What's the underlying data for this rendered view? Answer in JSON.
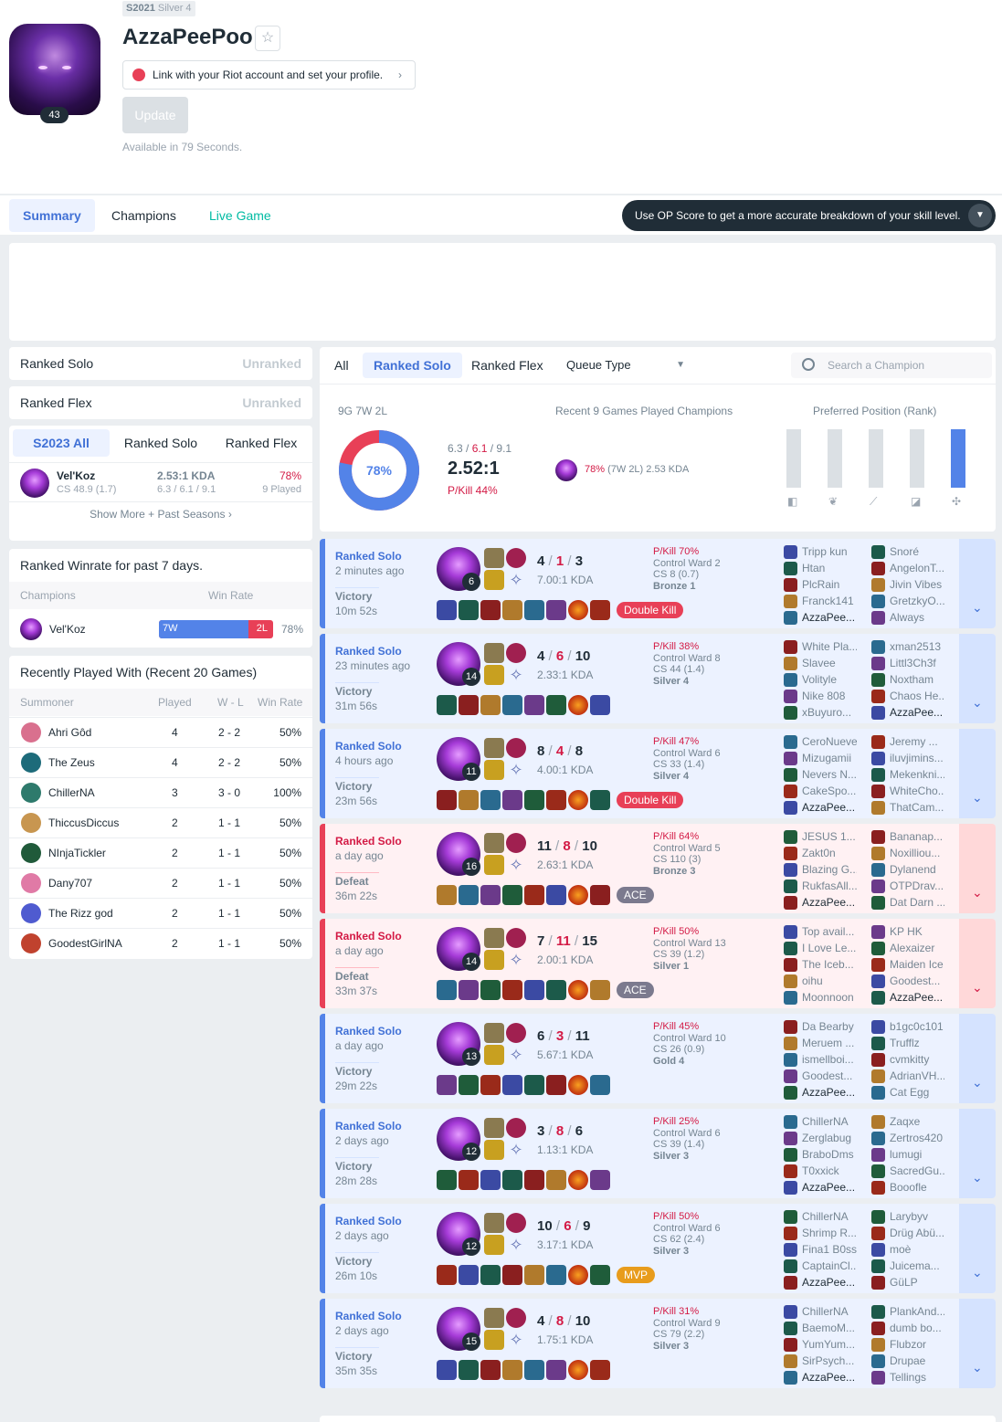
{
  "profile": {
    "tier_tag_season": "S2021",
    "tier_tag_rank": "Silver 4",
    "name": "AzzaPeePoo",
    "level": "43",
    "riot_link": "Link with your Riot account and set your profile.",
    "update_label": "Update",
    "available": "Available in 79 Seconds."
  },
  "tabs": {
    "summary": "Summary",
    "champions": "Champions",
    "live": "Live Game",
    "op_score": "Use OP Score to get a more accurate breakdown of your skill level."
  },
  "ranked": {
    "solo_label": "Ranked Solo",
    "solo_value": "Unranked",
    "flex_label": "Ranked Flex",
    "flex_value": "Unranked"
  },
  "season": {
    "tabs": [
      "S2023 All",
      "Ranked Solo",
      "Ranked Flex"
    ],
    "champ": "Vel'Koz",
    "cs": "CS 48.9 (1.7)",
    "kda": "2.53:1 KDA",
    "kda_detail": "6.3 / 6.1 / 9.1",
    "winrate": "78%",
    "played": "9 Played",
    "more": "Show More + Past Seasons"
  },
  "winrate7": {
    "title": "Ranked Winrate for past 7 days.",
    "col_champ": "Champions",
    "col_wr": "Win Rate",
    "champ": "Vel'Koz",
    "wins": "7W",
    "losses": "2L",
    "wr": "78%",
    "win_fraction": 0.78
  },
  "recent": {
    "title": "Recently Played With (Recent 20 Games)",
    "cols": [
      "Summoner",
      "Played",
      "W - L",
      "Win Rate"
    ],
    "rows": [
      {
        "name": "Ahri Gôd",
        "played": "4",
        "wl": "2 - 2",
        "wr": "50%",
        "color": "#d9708e"
      },
      {
        "name": "The Zeus",
        "played": "4",
        "wl": "2 - 2",
        "wr": "50%",
        "color": "#1d6b7a"
      },
      {
        "name": "ChillerNA",
        "played": "3",
        "wl": "3 - 0",
        "wr": "100%",
        "color": "#2e7a6c"
      },
      {
        "name": "ThiccusDiccus",
        "played": "2",
        "wl": "1 - 1",
        "wr": "50%",
        "color": "#c89650"
      },
      {
        "name": "NInjaTickler",
        "played": "2",
        "wl": "1 - 1",
        "wr": "50%",
        "color": "#205a3a"
      },
      {
        "name": "Dany707",
        "played": "2",
        "wl": "1 - 1",
        "wr": "50%",
        "color": "#e07aa6"
      },
      {
        "name": "The Rizz god",
        "played": "2",
        "wl": "1 - 1",
        "wr": "50%",
        "color": "#4f5bd0"
      },
      {
        "name": "GoodestGirlNA",
        "played": "2",
        "wl": "1 - 1",
        "wr": "50%",
        "color": "#c0422e"
      }
    ]
  },
  "filters": {
    "all": "All",
    "solo": "Ranked Solo",
    "flex": "Ranked Flex",
    "queue": "Queue Type",
    "search": "Search a Champion"
  },
  "summary": {
    "record": "9G 7W 2L",
    "winrate": "78%",
    "win_fraction": 0.78,
    "kda_line_k": "6.3",
    "kda_line_d": "6.1",
    "kda_line_a": "9.1",
    "kda": "2.52:1",
    "pkill": "P/Kill 44%",
    "recent_title": "Recent 9 Games Played Champions",
    "recent_wr": "78%",
    "recent_wl": "(7W 2L)",
    "recent_kda": "2.53 KDA",
    "pos_title": "Preferred Position (Rank)",
    "positions": [
      {
        "name": "top",
        "share": 0
      },
      {
        "name": "jungle",
        "share": 0
      },
      {
        "name": "mid",
        "share": 0
      },
      {
        "name": "adc",
        "share": 0
      },
      {
        "name": "support",
        "share": 1
      }
    ]
  },
  "matches": [
    {
      "queue": "Ranked Solo",
      "time": "2 minutes ago",
      "result": "Victory",
      "duration": "10m 52s",
      "lv": "6",
      "k": "4",
      "d": "1",
      "a": "3",
      "kda": "7.00:1 KDA",
      "pkill": "P/Kill 70%",
      "ward": "Control Ward 2",
      "cs": "CS 8 (0.7)",
      "tier": "Bronze 1",
      "badge": "Double Kill",
      "win": true,
      "team1": [
        "Tripp kun",
        "Htan",
        "PlcRain",
        "Franck141",
        "AzzaPee..."
      ],
      "team2": [
        "Snoré",
        "AngelonT...",
        "Jivin Vibes",
        "GretzkyO...",
        "Always"
      ]
    },
    {
      "queue": "Ranked Solo",
      "time": "23 minutes ago",
      "result": "Victory",
      "duration": "31m 56s",
      "lv": "14",
      "k": "4",
      "d": "6",
      "a": "10",
      "kda": "2.33:1 KDA",
      "pkill": "P/Kill 38%",
      "ward": "Control Ward 8",
      "cs": "CS 44 (1.4)",
      "tier": "Silver 4",
      "badge": "",
      "win": true,
      "team1": [
        "White Pla...",
        "Slavee",
        "Volityle",
        "Nike 808",
        "xBuyuro..."
      ],
      "team2": [
        "xman2513",
        "Littl3Ch3f",
        "Noxtham",
        "Chaos He...",
        "AzzaPee..."
      ]
    },
    {
      "queue": "Ranked Solo",
      "time": "4 hours ago",
      "result": "Victory",
      "duration": "23m 56s",
      "lv": "11",
      "k": "8",
      "d": "4",
      "a": "8",
      "kda": "4.00:1 KDA",
      "pkill": "P/Kill 47%",
      "ward": "Control Ward 6",
      "cs": "CS 33 (1.4)",
      "tier": "Silver 4",
      "badge": "Double Kill",
      "win": true,
      "team1": [
        "CeroNueve",
        "Mizugamii",
        "Nevers N...",
        "CakeSpo...",
        "AzzaPee..."
      ],
      "team2": [
        "Jeremy ...",
        "iluvjimins...",
        "Mekenkni...",
        "WhiteCho...",
        "ThatCam..."
      ]
    },
    {
      "queue": "Ranked Solo",
      "time": "a day ago",
      "result": "Defeat",
      "duration": "36m 22s",
      "lv": "16",
      "k": "11",
      "d": "8",
      "a": "10",
      "kda": "2.63:1 KDA",
      "pkill": "P/Kill 64%",
      "ward": "Control Ward 5",
      "cs": "CS 110 (3)",
      "tier": "Bronze 3",
      "badge": "ACE",
      "win": false,
      "team1": [
        "JESUS 1...",
        "Zakt0n",
        "Blazing G...",
        "RukfasAll...",
        "AzzaPee..."
      ],
      "team2": [
        "Bananap...",
        "Noxilliou...",
        "Dylanend",
        "OTPDrav...",
        "Dat Darn ..."
      ]
    },
    {
      "queue": "Ranked Solo",
      "time": "a day ago",
      "result": "Defeat",
      "duration": "33m 37s",
      "lv": "14",
      "k": "7",
      "d": "11",
      "a": "15",
      "kda": "2.00:1 KDA",
      "pkill": "P/Kill 50%",
      "ward": "Control Ward 13",
      "cs": "CS 39 (1.2)",
      "tier": "Silver 1",
      "badge": "ACE",
      "win": false,
      "team1": [
        "Top avail...",
        "I Love Le...",
        "The Iceb...",
        "oihu",
        "Moonnoon"
      ],
      "team2": [
        "KP HK",
        "Alexaizer",
        "Maiden Ice",
        "Goodest...",
        "AzzaPee..."
      ]
    },
    {
      "queue": "Ranked Solo",
      "time": "a day ago",
      "result": "Victory",
      "duration": "29m 22s",
      "lv": "13",
      "k": "6",
      "d": "3",
      "a": "11",
      "kda": "5.67:1 KDA",
      "pkill": "P/Kill 45%",
      "ward": "Control Ward 10",
      "cs": "CS 26 (0.9)",
      "tier": "Gold 4",
      "badge": "",
      "win": true,
      "team1": [
        "Da Bearby",
        "Meruem ...",
        "ismellboi...",
        "Goodest...",
        "AzzaPee..."
      ],
      "team2": [
        "b1gc0c101",
        "Trufflz",
        "cvmkitty",
        "AdrianVH...",
        "Cat Egg"
      ]
    },
    {
      "queue": "Ranked Solo",
      "time": "2 days ago",
      "result": "Victory",
      "duration": "28m 28s",
      "lv": "12",
      "k": "3",
      "d": "8",
      "a": "6",
      "kda": "1.13:1 KDA",
      "pkill": "P/Kill 25%",
      "ward": "Control Ward 6",
      "cs": "CS 39 (1.4)",
      "tier": "Silver 3",
      "badge": "",
      "win": true,
      "team1": [
        "ChillerNA",
        "Zerglabug",
        "BraboDms",
        "T0xxick",
        "AzzaPee..."
      ],
      "team2": [
        "Zaqxe",
        "Zertros420",
        "lumugi",
        "SacredGu...",
        "Booofle"
      ]
    },
    {
      "queue": "Ranked Solo",
      "time": "2 days ago",
      "result": "Victory",
      "duration": "26m 10s",
      "lv": "12",
      "k": "10",
      "d": "6",
      "a": "9",
      "kda": "3.17:1 KDA",
      "pkill": "P/Kill 50%",
      "ward": "Control Ward 6",
      "cs": "CS 62 (2.4)",
      "tier": "Silver 3",
      "badge": "MVP",
      "win": true,
      "team1": [
        "ChillerNA",
        "Shrimp R...",
        "Fina1 B0ss",
        "CaptainCl...",
        "AzzaPee..."
      ],
      "team2": [
        "Larybyv",
        "Drüg Abü...",
        "moè",
        "Juicema...",
        "GüLP"
      ]
    },
    {
      "queue": "Ranked Solo",
      "time": "2 days ago",
      "result": "Victory",
      "duration": "35m 35s",
      "lv": "15",
      "k": "4",
      "d": "8",
      "a": "10",
      "kda": "1.75:1 KDA",
      "pkill": "P/Kill 31%",
      "ward": "Control Ward 9",
      "cs": "CS 79 (2.2)",
      "tier": "Silver 3",
      "badge": "",
      "win": true,
      "team1": [
        "ChillerNA",
        "BaemoM...",
        "YumYum...",
        "SirPsych...",
        "AzzaPee..."
      ],
      "team2": [
        "PlankAnd...",
        "dumb bo...",
        "Flubzor",
        "Drupae",
        "Tellings"
      ]
    }
  ],
  "colors": {
    "blue": "#5383e8",
    "red": "#e84057",
    "double_kill": "#e84057",
    "ace": "#7b7a8e",
    "mvp": "#e89c1c"
  }
}
